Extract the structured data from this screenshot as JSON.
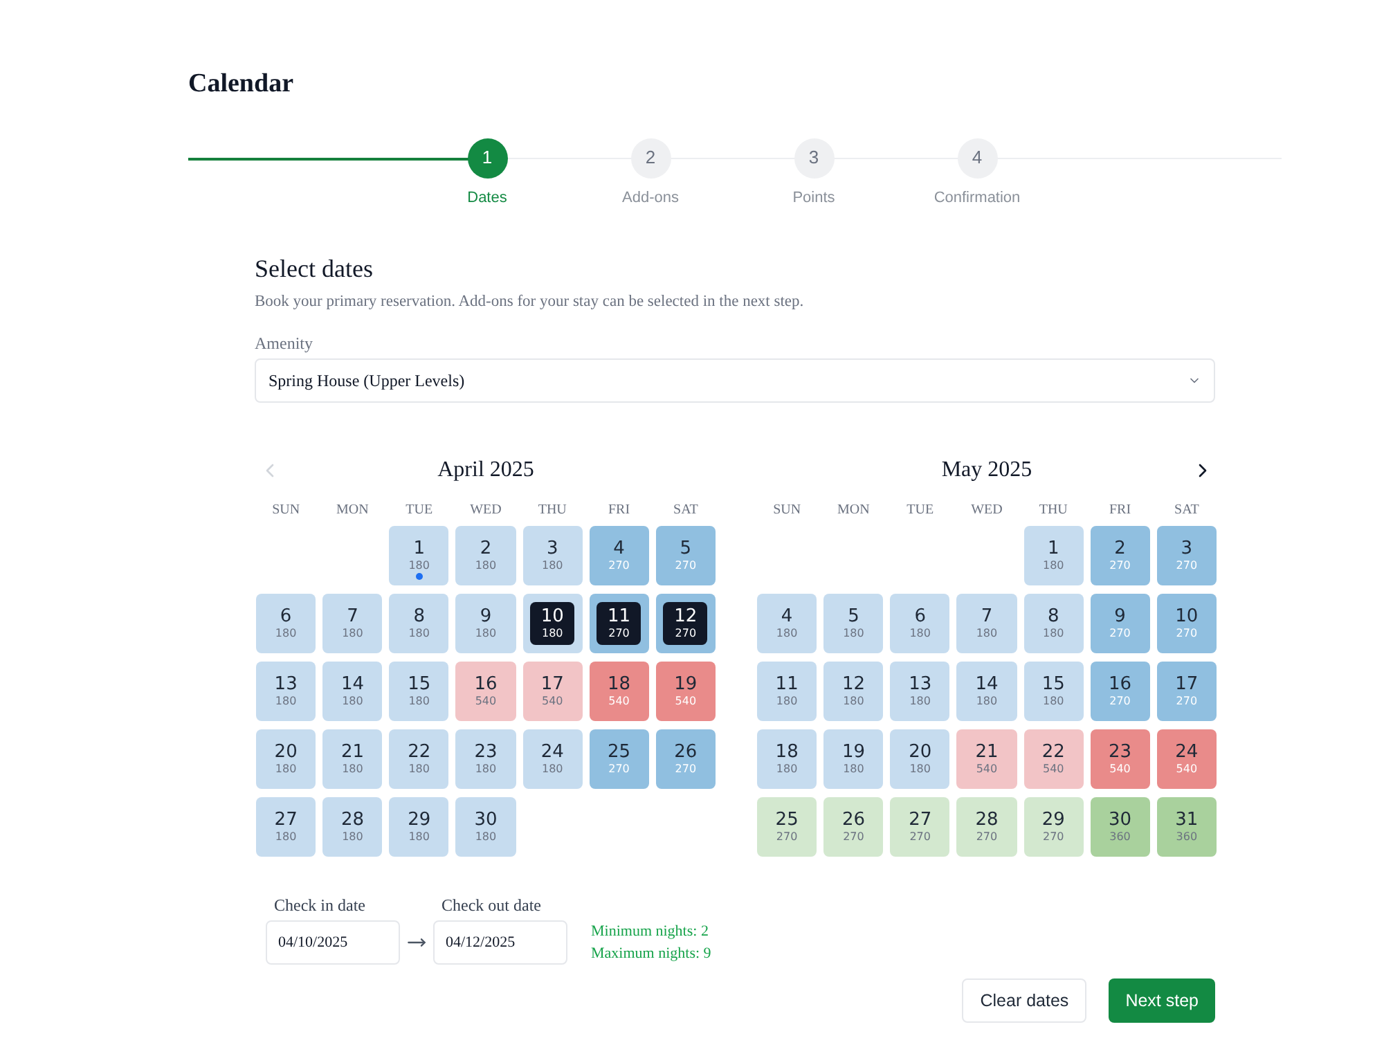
{
  "page_title": "Calendar",
  "steps": [
    {
      "number": "1",
      "label": "Dates",
      "selected": true
    },
    {
      "number": "2",
      "label": "Add-ons",
      "selected": false
    },
    {
      "number": "3",
      "label": "Points",
      "selected": false
    },
    {
      "number": "4",
      "label": "Confirmation",
      "selected": false
    }
  ],
  "section": {
    "title": "Select dates",
    "description": "Book your primary reservation. Add-ons for your stay can be selected in the next step."
  },
  "amenity": {
    "label": "Amenity",
    "value": "Spring House (Upper Levels)"
  },
  "months": [
    {
      "title": "April 2025",
      "nav": {
        "kind": "prev",
        "disabled": true
      },
      "weekdays": [
        "SUN",
        "MON",
        "TUE",
        "WED",
        "THU",
        "FRI",
        "SAT"
      ],
      "weeks": [
        [
          {
            "day": "1",
            "price": "180",
            "color": "#c6dcef",
            "selected": false,
            "today": true
          },
          {
            "day": "2",
            "price": "180",
            "color": "#c6dcef",
            "selected": false,
            "today": false
          },
          {
            "day": "3",
            "price": "180",
            "color": "#c6dcef",
            "selected": false,
            "today": false
          },
          {
            "day": "4",
            "price": "270",
            "color": "#90bfe0",
            "selected": false,
            "today": false
          },
          {
            "day": "5",
            "price": "270",
            "color": "#90bfe0",
            "selected": false,
            "today": false
          }
        ],
        [
          {
            "day": "6",
            "price": "180",
            "color": "#c6dcef",
            "selected": false,
            "today": false
          },
          {
            "day": "7",
            "price": "180",
            "color": "#c6dcef",
            "selected": false,
            "today": false
          },
          {
            "day": "8",
            "price": "180",
            "color": "#c6dcef",
            "selected": false,
            "today": false
          },
          {
            "day": "9",
            "price": "180",
            "color": "#c6dcef",
            "selected": false,
            "today": false
          },
          {
            "day": "10",
            "price": "180",
            "color": "#c6dcef",
            "selected": true,
            "today": false
          },
          {
            "day": "11",
            "price": "270",
            "color": "#90bfe0",
            "selected": true,
            "today": false
          },
          {
            "day": "12",
            "price": "270",
            "color": "#90bfe0",
            "selected": true,
            "today": false
          }
        ],
        [
          {
            "day": "13",
            "price": "180",
            "color": "#c6dcef",
            "selected": false,
            "today": false
          },
          {
            "day": "14",
            "price": "180",
            "color": "#c6dcef",
            "selected": false,
            "today": false
          },
          {
            "day": "15",
            "price": "180",
            "color": "#c6dcef",
            "selected": false,
            "today": false
          },
          {
            "day": "16",
            "price": "540",
            "color": "#f2c4c6",
            "selected": false,
            "today": false
          },
          {
            "day": "17",
            "price": "540",
            "color": "#f2c4c6",
            "selected": false,
            "today": false
          },
          {
            "day": "18",
            "price": "540",
            "color": "#e98b8a",
            "selected": false,
            "today": false
          },
          {
            "day": "19",
            "price": "540",
            "color": "#e98b8a",
            "selected": false,
            "today": false
          }
        ],
        [
          {
            "day": "20",
            "price": "180",
            "color": "#c6dcef",
            "selected": false,
            "today": false
          },
          {
            "day": "21",
            "price": "180",
            "color": "#c6dcef",
            "selected": false,
            "today": false
          },
          {
            "day": "22",
            "price": "180",
            "color": "#c6dcef",
            "selected": false,
            "today": false
          },
          {
            "day": "23",
            "price": "180",
            "color": "#c6dcef",
            "selected": false,
            "today": false
          },
          {
            "day": "24",
            "price": "180",
            "color": "#c6dcef",
            "selected": false,
            "today": false
          },
          {
            "day": "25",
            "price": "270",
            "color": "#90bfe0",
            "selected": false,
            "today": false
          },
          {
            "day": "26",
            "price": "270",
            "color": "#90bfe0",
            "selected": false,
            "today": false
          }
        ],
        [
          {
            "day": "27",
            "price": "180",
            "color": "#c6dcef",
            "selected": false,
            "today": false
          },
          {
            "day": "28",
            "price": "180",
            "color": "#c6dcef",
            "selected": false,
            "today": false
          },
          {
            "day": "29",
            "price": "180",
            "color": "#c6dcef",
            "selected": false,
            "today": false
          },
          {
            "day": "30",
            "price": "180",
            "color": "#c6dcef",
            "selected": false,
            "today": false
          }
        ]
      ]
    },
    {
      "title": "May 2025",
      "nav": {
        "kind": "next",
        "disabled": false
      },
      "weekdays": [
        "SUN",
        "MON",
        "TUE",
        "WED",
        "THU",
        "FRI",
        "SAT"
      ],
      "weeks": [
        [
          {
            "day": "1",
            "price": "180",
            "color": "#c6dcef",
            "selected": false,
            "today": false
          },
          {
            "day": "2",
            "price": "270",
            "color": "#90bfe0",
            "selected": false,
            "today": false
          },
          {
            "day": "3",
            "price": "270",
            "color": "#90bfe0",
            "selected": false,
            "today": false
          }
        ],
        [
          {
            "day": "4",
            "price": "180",
            "color": "#c6dcef",
            "selected": false,
            "today": false
          },
          {
            "day": "5",
            "price": "180",
            "color": "#c6dcef",
            "selected": false,
            "today": false
          },
          {
            "day": "6",
            "price": "180",
            "color": "#c6dcef",
            "selected": false,
            "today": false
          },
          {
            "day": "7",
            "price": "180",
            "color": "#c6dcef",
            "selected": false,
            "today": false
          },
          {
            "day": "8",
            "price": "180",
            "color": "#c6dcef",
            "selected": false,
            "today": false
          },
          {
            "day": "9",
            "price": "270",
            "color": "#90bfe0",
            "selected": false,
            "today": false
          },
          {
            "day": "10",
            "price": "270",
            "color": "#90bfe0",
            "selected": false,
            "today": false
          }
        ],
        [
          {
            "day": "11",
            "price": "180",
            "color": "#c6dcef",
            "selected": false,
            "today": false
          },
          {
            "day": "12",
            "price": "180",
            "color": "#c6dcef",
            "selected": false,
            "today": false
          },
          {
            "day": "13",
            "price": "180",
            "color": "#c6dcef",
            "selected": false,
            "today": false
          },
          {
            "day": "14",
            "price": "180",
            "color": "#c6dcef",
            "selected": false,
            "today": false
          },
          {
            "day": "15",
            "price": "180",
            "color": "#c6dcef",
            "selected": false,
            "today": false
          },
          {
            "day": "16",
            "price": "270",
            "color": "#90bfe0",
            "selected": false,
            "today": false
          },
          {
            "day": "17",
            "price": "270",
            "color": "#90bfe0",
            "selected": false,
            "today": false
          }
        ],
        [
          {
            "day": "18",
            "price": "180",
            "color": "#c6dcef",
            "selected": false,
            "today": false
          },
          {
            "day": "19",
            "price": "180",
            "color": "#c6dcef",
            "selected": false,
            "today": false
          },
          {
            "day": "20",
            "price": "180",
            "color": "#c6dcef",
            "selected": false,
            "today": false
          },
          {
            "day": "21",
            "price": "540",
            "color": "#f2c4c6",
            "selected": false,
            "today": false
          },
          {
            "day": "22",
            "price": "540",
            "color": "#f2c4c6",
            "selected": false,
            "today": false
          },
          {
            "day": "23",
            "price": "540",
            "color": "#e98b8a",
            "selected": false,
            "today": false
          },
          {
            "day": "24",
            "price": "540",
            "color": "#e98b8a",
            "selected": false,
            "today": false
          }
        ],
        [
          {
            "day": "25",
            "price": "270",
            "color": "#d3e8cf",
            "selected": false,
            "today": false
          },
          {
            "day": "26",
            "price": "270",
            "color": "#d3e8cf",
            "selected": false,
            "today": false
          },
          {
            "day": "27",
            "price": "270",
            "color": "#d3e8cf",
            "selected": false,
            "today": false
          },
          {
            "day": "28",
            "price": "270",
            "color": "#d3e8cf",
            "selected": false,
            "today": false
          },
          {
            "day": "29",
            "price": "270",
            "color": "#d3e8cf",
            "selected": false,
            "today": false
          },
          {
            "day": "30",
            "price": "360",
            "color": "#a9d19d",
            "selected": false,
            "today": false
          },
          {
            "day": "31",
            "price": "360",
            "color": "#a9d19d",
            "selected": false,
            "today": false
          }
        ]
      ]
    }
  ],
  "check_in": {
    "label": "Check in date",
    "value": "04/10/2025"
  },
  "check_out": {
    "label": "Check out date",
    "value": "04/12/2025"
  },
  "rules": [
    "Minimum nights: 2",
    "Maximum nights: 9"
  ],
  "buttons": [
    {
      "label": "Clear dates",
      "kind": "secondary"
    },
    {
      "label": "Next step",
      "kind": "primary"
    }
  ]
}
